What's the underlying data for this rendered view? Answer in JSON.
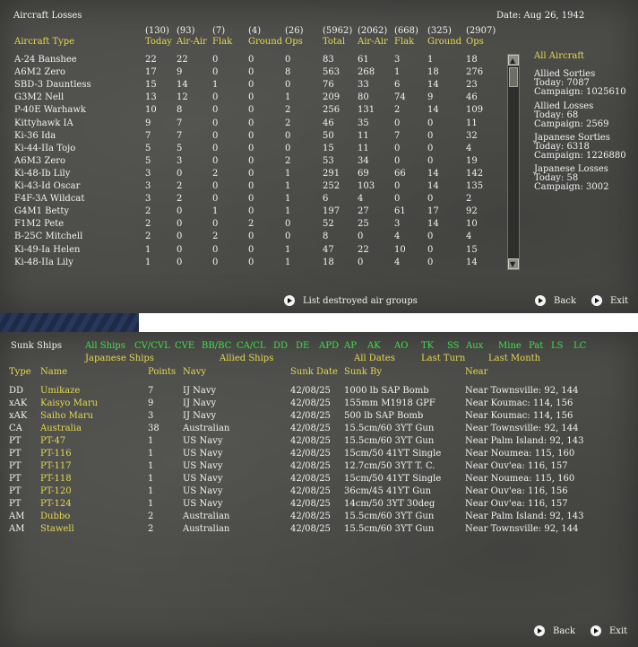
{
  "losses": {
    "title": "Aircraft Losses",
    "date": "Date: Aug 26, 1942",
    "header_totals": [
      "(130)",
      "(93)",
      "(7)",
      "(4)",
      "(26)",
      "(5962)",
      "(2062)",
      "(668)",
      "(325)",
      "(2907)"
    ],
    "header_labels": [
      "Aircraft Type",
      "Today",
      "Air-Air",
      "Flak",
      "Ground",
      "Ops",
      "Total",
      "Air-Air",
      "Flak",
      "Ground",
      "Ops"
    ],
    "rows": [
      [
        "A-24 Banshee",
        "22",
        "22",
        "0",
        "0",
        "0",
        "83",
        "61",
        "3",
        "1",
        "18"
      ],
      [
        "A6M2 Zero",
        "17",
        "9",
        "0",
        "0",
        "8",
        "563",
        "268",
        "1",
        "18",
        "276"
      ],
      [
        "SBD-3 Dauntless",
        "15",
        "14",
        "1",
        "0",
        "0",
        "76",
        "33",
        "6",
        "14",
        "23"
      ],
      [
        "G3M2 Nell",
        "13",
        "12",
        "0",
        "0",
        "1",
        "209",
        "80",
        "74",
        "9",
        "46"
      ],
      [
        "P-40E Warhawk",
        "10",
        "8",
        "0",
        "0",
        "2",
        "256",
        "131",
        "2",
        "14",
        "109"
      ],
      [
        "Kittyhawk IA",
        "9",
        "7",
        "0",
        "0",
        "2",
        "46",
        "35",
        "0",
        "0",
        "11"
      ],
      [
        "Ki-36 Ida",
        "7",
        "7",
        "0",
        "0",
        "0",
        "50",
        "11",
        "7",
        "0",
        "32"
      ],
      [
        "Ki-44-IIa Tojo",
        "5",
        "5",
        "0",
        "0",
        "0",
        "15",
        "11",
        "0",
        "0",
        "4"
      ],
      [
        "A6M3 Zero",
        "5",
        "3",
        "0",
        "0",
        "2",
        "53",
        "34",
        "0",
        "0",
        "19"
      ],
      [
        "Ki-48-Ib Lily",
        "3",
        "0",
        "2",
        "0",
        "1",
        "291",
        "69",
        "66",
        "14",
        "142"
      ],
      [
        "Ki-43-Id Oscar",
        "3",
        "2",
        "0",
        "0",
        "1",
        "252",
        "103",
        "0",
        "14",
        "135"
      ],
      [
        "F4F-3A Wildcat",
        "3",
        "2",
        "0",
        "0",
        "1",
        "6",
        "4",
        "0",
        "0",
        "2"
      ],
      [
        "G4M1 Betty",
        "2",
        "0",
        "1",
        "0",
        "1",
        "197",
        "27",
        "61",
        "17",
        "92"
      ],
      [
        "F1M2 Pete",
        "2",
        "0",
        "0",
        "2",
        "0",
        "52",
        "25",
        "3",
        "14",
        "10"
      ],
      [
        "B-25C Mitchell",
        "2",
        "0",
        "2",
        "0",
        "0",
        "8",
        "0",
        "4",
        "0",
        "4"
      ],
      [
        "Ki-49-Ia Helen",
        "1",
        "0",
        "0",
        "0",
        "1",
        "47",
        "22",
        "10",
        "0",
        "15"
      ],
      [
        "Ki-48-IIa Lily",
        "1",
        "0",
        "0",
        "0",
        "1",
        "18",
        "0",
        "4",
        "0",
        "14"
      ]
    ],
    "side": {
      "all_aircraft": "All Aircraft",
      "allied_sorties": "Allied Sorties",
      "allied_sorties_today": "Today:   7087",
      "allied_sorties_campaign": "Campaign: 1025610",
      "allied_losses": "Allied Losses",
      "allied_losses_today": "Today:   68",
      "allied_losses_campaign": "Campaign: 2569",
      "jap_sorties": "Japanese Sorties",
      "jap_sorties_today": "Today:   6318",
      "jap_sorties_campaign": "Campaign: 1226880",
      "jap_losses": "Japanese Losses",
      "jap_losses_today": "Today:   58",
      "jap_losses_campaign": "Campaign: 3002"
    },
    "list_destroyed": "List destroyed air groups",
    "back": "Back",
    "exit": "Exit"
  },
  "sunk": {
    "title": "Sunk Ships",
    "filters_row1": [
      "All Ships",
      "CV/CVL",
      "CVE",
      "BB/BC",
      "CA/CL",
      "DD",
      "DE",
      "APD",
      "AP",
      "AK",
      "AO",
      "TK",
      "SS",
      "Aux",
      "Mine",
      "Pat",
      "LS",
      "LC"
    ],
    "filters_row2": [
      "Japanese Ships",
      "Allied Ships",
      "All Dates",
      "Last Turn",
      "Last Month"
    ],
    "headers": [
      "Type",
      "Name",
      "Points",
      "Navy",
      "Sunk Date",
      "Sunk By",
      "Near"
    ],
    "rows": [
      [
        "DD",
        "Umikaze",
        "7",
        "IJ Navy",
        "42/08/25",
        "1000 lb SAP Bomb",
        "Near Townsville: 92, 144"
      ],
      [
        "xAK",
        "Kaisyo Maru",
        "9",
        "IJ Navy",
        "42/08/25",
        "155mm M1918 GPF",
        "Near Koumac: 114, 156"
      ],
      [
        "xAK",
        "Saiho Maru",
        "3",
        "IJ Navy",
        "42/08/25",
        "500 lb SAP Bomb",
        "Near Koumac: 114, 156"
      ],
      [
        "CA",
        "Australia",
        "38",
        "Australian",
        "42/08/25",
        "15.5cm/60 3YT Gun",
        "Near Townsville: 92, 144"
      ],
      [
        "PT",
        "PT-47",
        "1",
        "US Navy",
        "42/08/25",
        "15.5cm/60 3YT Gun",
        "Near Palm Island: 92, 143"
      ],
      [
        "PT",
        "PT-116",
        "1",
        "US Navy",
        "42/08/25",
        "15cm/50 41YT Single",
        "Near Noumea: 115, 160"
      ],
      [
        "PT",
        "PT-117",
        "1",
        "US Navy",
        "42/08/25",
        "12.7cm/50 3YT T. C.",
        "Near Ouv'ea: 116, 157"
      ],
      [
        "PT",
        "PT-118",
        "1",
        "US Navy",
        "42/08/25",
        "15cm/50 41YT Single",
        "Near Noumea: 115, 160"
      ],
      [
        "PT",
        "PT-120",
        "1",
        "US Navy",
        "42/08/25",
        "36cm/45 41YT Gun",
        "Near Ouv'ea: 116, 156"
      ],
      [
        "PT",
        "PT-124",
        "1",
        "US Navy",
        "42/08/25",
        "14cm/50 3YT 30deg",
        "Near Ouv'ea: 116, 157"
      ],
      [
        "AM",
        "Dubbo",
        "2",
        "Australian",
        "42/08/25",
        "15.5cm/60 3YT Gun",
        "Near Palm Island: 92, 143"
      ],
      [
        "AM",
        "Stawell",
        "2",
        "Australian",
        "42/08/25",
        "15.5cm/60 3YT Gun",
        "Near Townsville: 92, 144"
      ]
    ],
    "back": "Back",
    "exit": "Exit"
  }
}
